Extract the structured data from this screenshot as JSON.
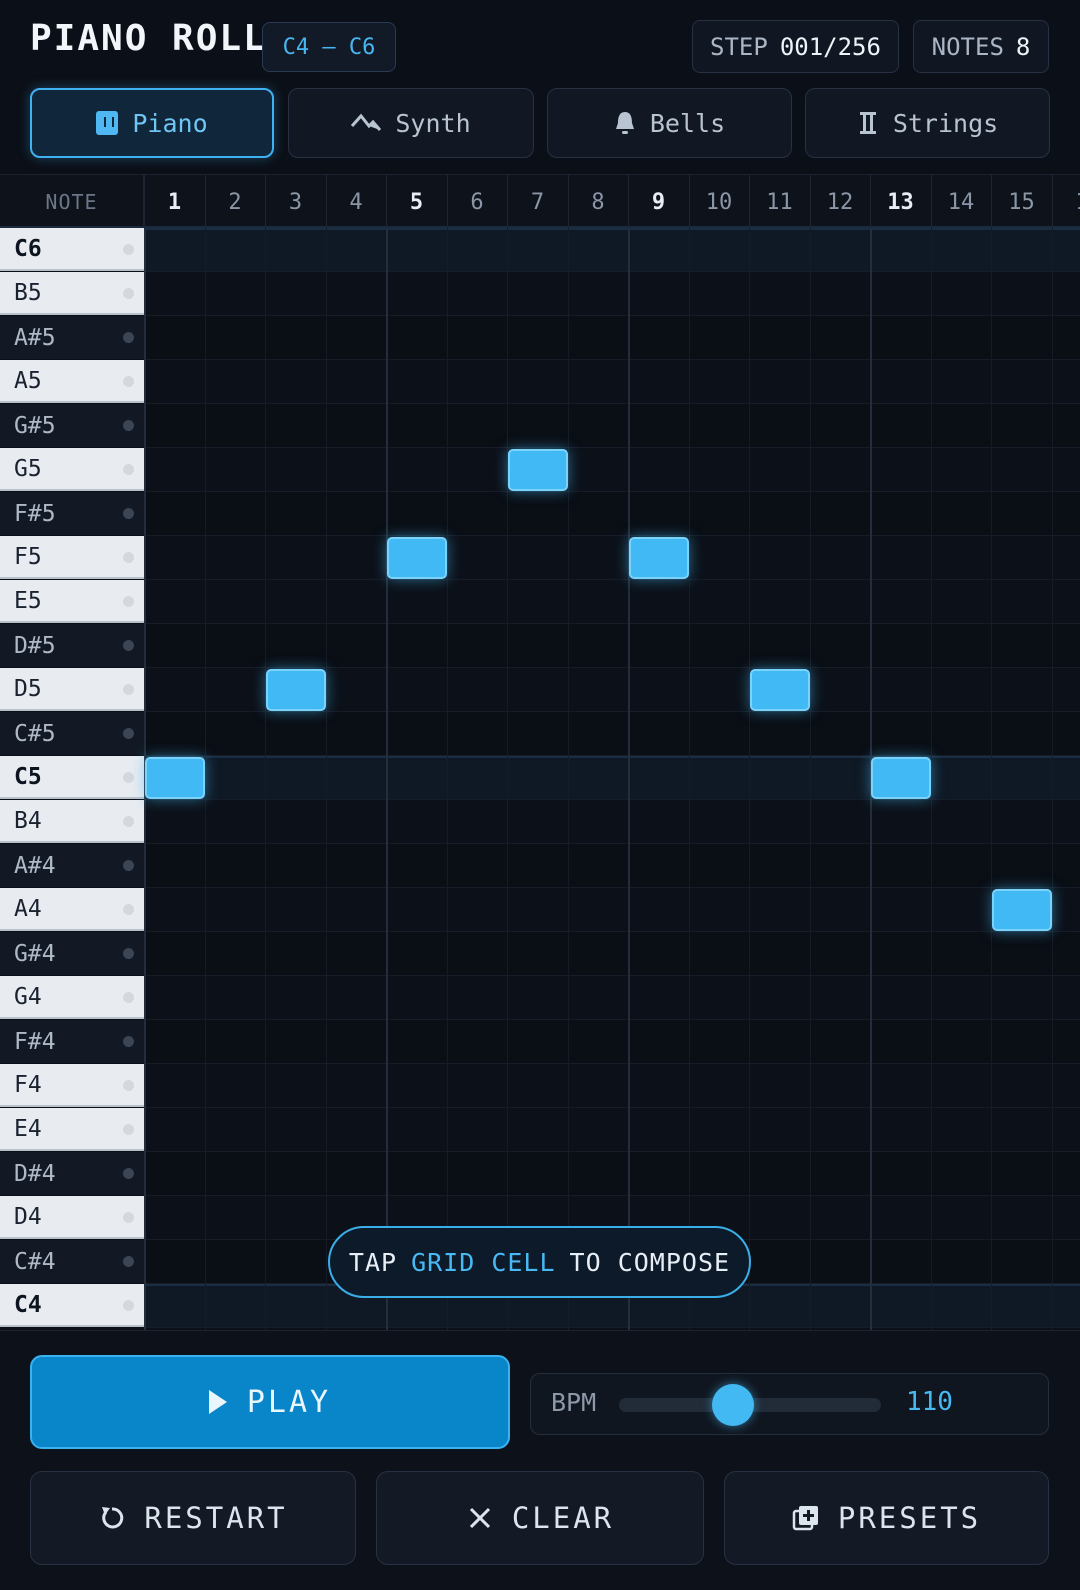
{
  "header": {
    "title": "PIANO ROLL",
    "range": "C4 – C6",
    "step_label": "STEP",
    "step_value": "001/256",
    "notes_label": "NOTES",
    "notes_value": "8"
  },
  "tabs": [
    {
      "label": "Piano",
      "icon": "piano-icon",
      "active": true
    },
    {
      "label": "Synth",
      "icon": "synth-wave-icon",
      "active": false
    },
    {
      "label": "Bells",
      "icon": "bell-icon",
      "active": false
    },
    {
      "label": "Strings",
      "icon": "strings-icon",
      "active": false
    }
  ],
  "grid": {
    "note_header": "NOTE",
    "columns": [
      "1",
      "2",
      "3",
      "4",
      "5",
      "6",
      "7",
      "8",
      "9",
      "10",
      "11",
      "12",
      "13",
      "14",
      "15",
      "1"
    ],
    "rows": [
      "C6",
      "B5",
      "A#5",
      "A5",
      "G#5",
      "G5",
      "F#5",
      "F5",
      "E5",
      "D#5",
      "D5",
      "C#5",
      "C5",
      "B4",
      "A#4",
      "A4",
      "G#4",
      "G4",
      "F#4",
      "F4",
      "E4",
      "D#4",
      "D4",
      "C#4",
      "C4"
    ],
    "notes": [
      {
        "step": 1,
        "pitch": "C5"
      },
      {
        "step": 3,
        "pitch": "D5"
      },
      {
        "step": 5,
        "pitch": "F5"
      },
      {
        "step": 7,
        "pitch": "G5"
      },
      {
        "step": 9,
        "pitch": "F5"
      },
      {
        "step": 11,
        "pitch": "D5"
      },
      {
        "step": 13,
        "pitch": "C5"
      },
      {
        "step": 15,
        "pitch": "A4"
      }
    ]
  },
  "hint": {
    "part1": "TAP",
    "highlight": "GRID CELL",
    "part2": "TO COMPOSE"
  },
  "controls": {
    "play_label": "PLAY",
    "bpm_label": "BPM",
    "bpm_value": "110",
    "restart_label": "RESTART",
    "clear_label": "CLEAR",
    "presets_label": "PRESETS"
  },
  "colors": {
    "accent": "#41b9f5",
    "background": "#0b0f17",
    "play_button": "#0985c9"
  }
}
